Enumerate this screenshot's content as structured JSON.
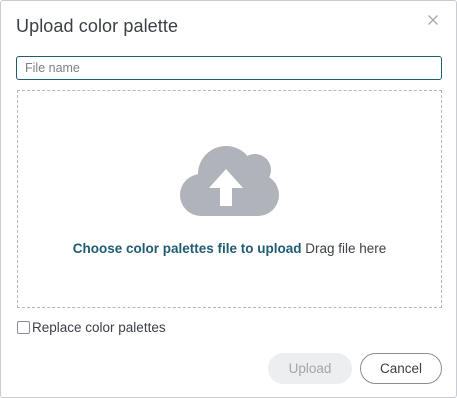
{
  "dialog": {
    "title": "Upload color palette",
    "close_icon": "close-icon"
  },
  "file_field": {
    "placeholder": "File name",
    "value": ""
  },
  "dropzone": {
    "icon": "cloud-upload-icon",
    "choose_label": "Choose color palettes file to upload",
    "drag_label": "Drag file here"
  },
  "options": {
    "replace_label": "Replace color palettes",
    "replace_checked": false
  },
  "buttons": {
    "upload_label": "Upload",
    "upload_disabled": true,
    "cancel_label": "Cancel"
  },
  "colors": {
    "accent": "#1f5c74",
    "cloud": "#b0b3ba",
    "text": "#3b3f45",
    "disabled_bg": "#eceef0",
    "disabled_text": "#a2a6ab"
  }
}
